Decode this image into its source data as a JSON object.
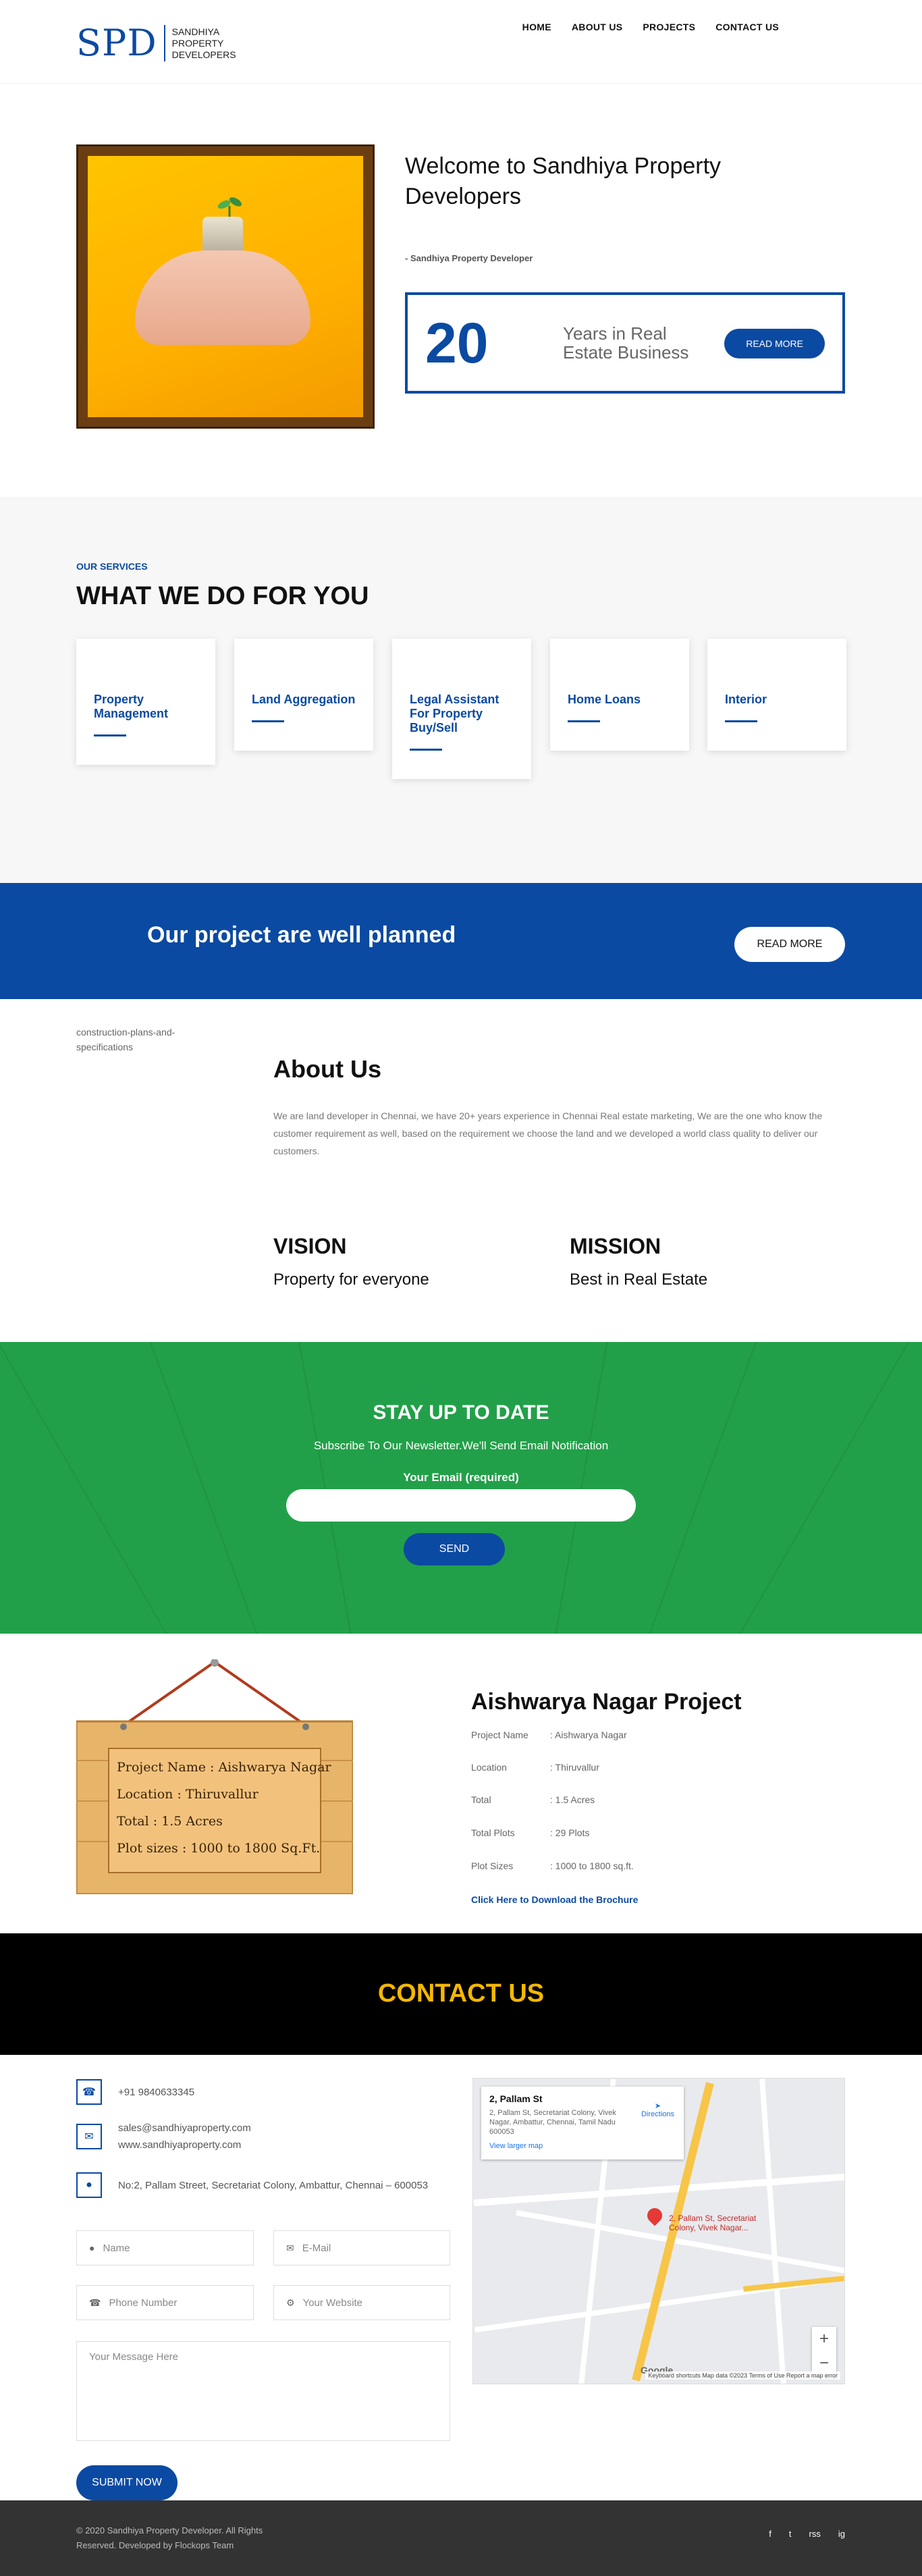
{
  "header": {
    "logo_mark": "SPD",
    "logo_text": [
      "SANDHIYA",
      "PROPERTY",
      "DEVELOPERS"
    ],
    "nav": [
      "HOME",
      "ABOUT US",
      "PROJECTS",
      "CONTACT US"
    ]
  },
  "welcome": {
    "title": "Welcome to Sandhiya Property Developers",
    "subtitle": "- Sandhiya Property Developer",
    "years_number": "20",
    "years_text": "Years in Real Estate Business",
    "read_more": "READ MORE"
  },
  "services": {
    "kicker": "OUR SERVICES",
    "title": "WHAT WE DO FOR YOU",
    "items": [
      "Property Management",
      "Land Aggregation",
      "Legal Assistant For Property Buy/Sell",
      "Home Loans",
      "Interior"
    ]
  },
  "banner": {
    "text": "Our project are well planned",
    "button": "READ MORE"
  },
  "about": {
    "image_alt": "construction-plans-and-specifications",
    "title": "About Us",
    "body": "We are land developer in Chennai, we have 20+ years experience in Chennai Real estate marketing, We are the one who know the customer requirement as well, based on the requirement we choose the land and we developed a world class quality to deliver our customers.",
    "vision_title": "VISION",
    "vision_text": "Property for everyone",
    "mission_title": "MISSION",
    "mission_text": "Best in Real Estate"
  },
  "newsletter": {
    "title": "STAY UP TO DATE",
    "subtitle": "Subscribe To Our Newsletter.We'll Send Email Notification",
    "email_label": "Your Email (required)",
    "send": "SEND"
  },
  "project": {
    "board_lines": [
      "Project Name : Aishwarya Nagar",
      "Location : Thiruvallur",
      "Total : 1.5 Acres",
      "Plot sizes : 1000 to 1800 Sq.Ft."
    ],
    "title": "Aishwarya Nagar Project",
    "rows": [
      {
        "k": "Project Name",
        "v": ": Aishwarya Nagar"
      },
      {
        "k": "Location",
        "v": ": Thiruvallur"
      },
      {
        "k": "Total",
        "v": ": 1.5 Acres"
      },
      {
        "k": "Total Plots",
        "v": ": 29 Plots"
      },
      {
        "k": "Plot Sizes",
        "v": ": 1000 to 1800 sq.ft."
      }
    ],
    "brochure": "Click Here to Download the Brochure"
  },
  "contact": {
    "title": "CONTACT US",
    "phone": "+91 9840633345",
    "email": "sales@sandhiyaproperty.com",
    "website": "www.sandhiyaproperty.com",
    "address": "No:2, Pallam Street, Secretariat Colony, Ambattur, Chennai – 600053",
    "name_ph": "Name",
    "email_ph": "E-Mail",
    "phone_ph": "Phone Number",
    "website_ph": "Your Website",
    "message_ph": "Your Message Here",
    "submit": "SUBMIT NOW"
  },
  "map": {
    "place": "2, Pallam St",
    "address": "2, Pallam St, Secretariat Colony, Vivek Nagar, Ambattur, Chennai, Tamil Nadu 600053",
    "larger": "View larger map",
    "directions": "Directions",
    "pin_label": "2, Pallam St, Secretariat Colony, Vivek Nagar...",
    "google": "Google",
    "footer": "Keyboard shortcuts  Map data ©2023  Terms of Use  Report a map error"
  },
  "footer": {
    "copyright": "© 2020 Sandhiya Property Developer. All Rights Reserved. Developed by Flockops Team",
    "social": [
      "f",
      "t",
      "rss",
      "ig"
    ]
  }
}
